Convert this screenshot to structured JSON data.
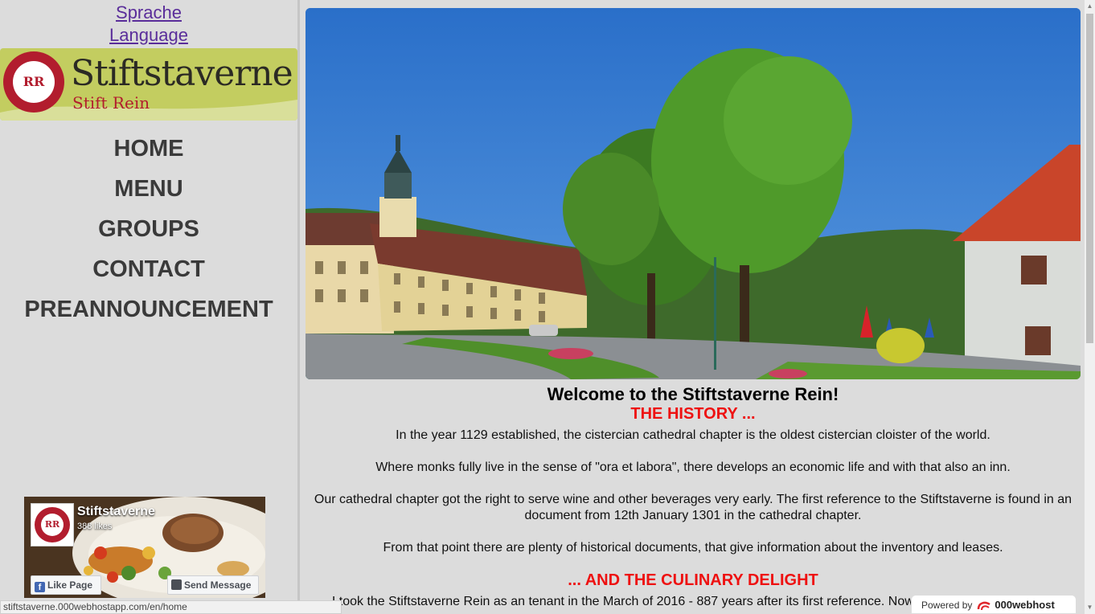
{
  "language_links": [
    "Sprache",
    "Language"
  ],
  "logo": {
    "title": "Stiftstaverne",
    "subtitle": "Stift Rein",
    "seal_mark": "RR",
    "brand_red": "#b21d2e",
    "brand_green": "#c3cd60"
  },
  "nav": [
    "HOME",
    "MENU",
    "GROUPS",
    "CONTACT",
    "PREANNOUNCEMENT"
  ],
  "facebook": {
    "name": "Stiftstaverne",
    "likes": "388 likes",
    "like_button": "Like Page",
    "send_button": "Send Message",
    "icons": [
      "facebook-f-icon",
      "messenger-icon"
    ]
  },
  "hero_alt": "",
  "content": {
    "welcome": "Welcome to the Stiftstaverne Rein!",
    "history_heading": "THE HISTORY ...",
    "p1": "In the year 1129 established, the cistercian cathedral chapter is the oldest cistercian cloister of the world.",
    "p2": "Where monks fully live in the sense of \"ora et labora\", there develops an economic life and with that also an inn.",
    "p3": "Our cathedral chapter got the right to serve wine and other beverages very early. The first reference to the Stiftstaverne is found in an document from 12th January 1301 in the cathedral chapter.",
    "p4": "From that point there are plenty of historical documents, that give information about the inventory and leases.",
    "culinary_heading": "... AND THE CULINARY DELIGHT",
    "p5": "I took the Stiftstaverne Rein as an tenant in the March of 2016 - 887 years after its first reference. Now when you are on such a"
  },
  "status_url": "stiftstaverne.000webhostapp.com/en/home",
  "badge": {
    "powered_by": "Powered by",
    "name": "000webhost"
  },
  "colors": {
    "heading_red": "#ee1111",
    "link_purple": "#5a2d9a",
    "nav_text": "#3a3a3a",
    "page_bg": "#dcdcdc"
  }
}
